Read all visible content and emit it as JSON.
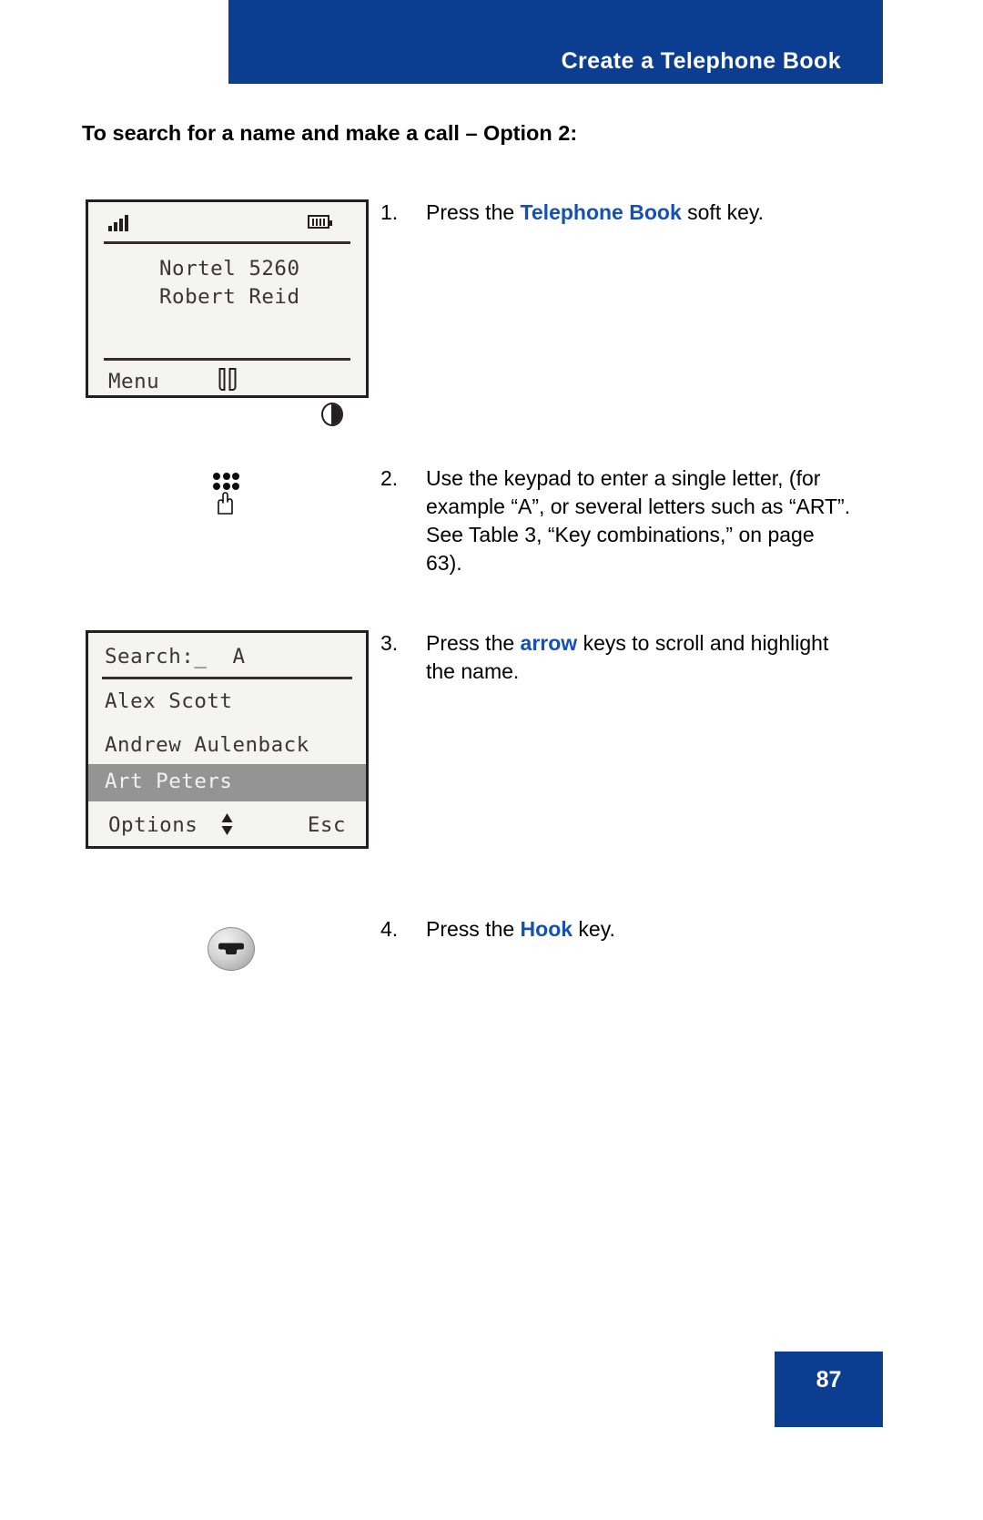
{
  "header": {
    "title": "Create a Telephone Book"
  },
  "section": {
    "heading": "To search for a name and make a call – Option 2:"
  },
  "phone_screen_1": {
    "status": {
      "signal_icon": "signal-bars-icon",
      "battery_icon": "battery-icon"
    },
    "lines": [
      "Nortel 5260",
      "Robert Reid"
    ],
    "softkeys": {
      "left": "Menu",
      "middle_icon": "telephone-book-icon",
      "right_icon": "half-moon-icon"
    }
  },
  "phone_screen_2": {
    "search_label": "Search:_",
    "search_value": "A",
    "search_line": "Search:_  A",
    "list": [
      {
        "name": "Alex Scott",
        "selected": false
      },
      {
        "name": "Andrew Aulenback",
        "selected": false
      },
      {
        "name": "Art Peters",
        "selected": true
      }
    ],
    "softkeys": {
      "left": "Options",
      "middle_icon": "up-down-arrow-icon",
      "right": "Esc"
    }
  },
  "steps": [
    {
      "number": "1.",
      "text_before": "Press the ",
      "keyword": "Telephone Book",
      "text_after": " soft key."
    },
    {
      "number": "2.",
      "text_full": "Use the keypad to enter a single letter, (for example “A”, or several letters such as “ART”. See Table 3, “Key combinations,” on page 63).",
      "icon": "keypad-icon"
    },
    {
      "number": "3.",
      "text_before": "Press the ",
      "keyword": "arrow",
      "text_after": " keys to scroll and highlight the name."
    },
    {
      "number": "4.",
      "text_before": "Press the ",
      "keyword": "Hook",
      "text_after": " key.",
      "icon": "hook-key-icon"
    }
  ],
  "footer": {
    "page_number": "87"
  },
  "colors": {
    "brand_blue": "#0b3d91",
    "keyword_blue": "#1451b4",
    "lcd_background": "#f4f4f2",
    "lcd_text": "#3b3634",
    "highlight_gray": "#949494"
  }
}
